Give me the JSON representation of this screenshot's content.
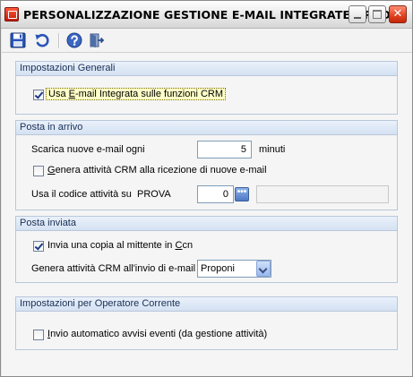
{
  "window": {
    "title": "PERSONALIZZAZIONE GESTIONE E-MAIL INTEGRATE <PRO...",
    "close_glyph": "✕"
  },
  "toolbar": {
    "icons": [
      "save-icon",
      "undo-icon",
      "help-icon",
      "exit-icon"
    ]
  },
  "groups": {
    "general": {
      "title": "Impostazioni Generali",
      "use_integrated_prefix": "Usa ",
      "use_integrated_mnemonic": "E",
      "use_integrated_rest": "-mail Integrata sulle funzioni CRM",
      "use_integrated_checked": true
    },
    "incoming": {
      "title": "Posta in arrivo",
      "download_label": "Scarica nuove e-mail ogni",
      "download_value": "5",
      "download_unit": "minuti",
      "generate_label_prefix": "G",
      "generate_label_rest": "enera attività CRM alla ricezione di nuove e-mail",
      "generate_checked": false,
      "activity_code_label": "Usa il codice attività su",
      "activity_code_target": "PROVA",
      "activity_code_value": "0",
      "lookup_glyph": "•••"
    },
    "outgoing": {
      "title": "Posta inviata",
      "send_copy_prefix": "Invia una copia al mittente in ",
      "send_copy_mnemonic": "C",
      "send_copy_rest": "cn",
      "send_copy_checked": true,
      "generate_label": "Genera attività CRM all'invio di e-mail",
      "generate_selected": "Proponi"
    },
    "operator": {
      "title": "Impostazioni per Operatore Corrente",
      "auto_notice_prefix": "I",
      "auto_notice_rest": "nvio automatico avvisi eventi (da gestione attività)",
      "auto_notice_checked": false
    }
  },
  "colors": {
    "accent": "#1d3a8a",
    "group_header": "#d4e1f2",
    "close_button": "#e0401f"
  }
}
